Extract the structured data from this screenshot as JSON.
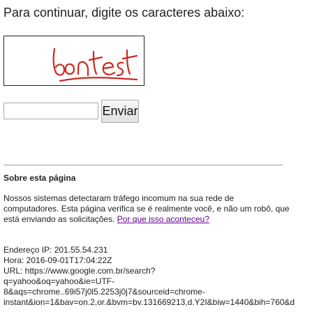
{
  "prompt": "Para continuar, digite os caracteres abaixo:",
  "captcha": {
    "text": "bontest",
    "ink_color": "#cc2a1e"
  },
  "answer_input": {
    "value": "",
    "placeholder": ""
  },
  "submit_label": "Enviar",
  "about": {
    "title": "Sobre esta página",
    "body": "Nossos sistemas detectaram tráfego incomum na sua rede de computadores. Esta página verifica se é realmente você, e não um robô, que está enviando as solicitações.",
    "link": "Por que isso aconteceu?"
  },
  "details": {
    "ip": "Endereço IP: 201.55.54.231",
    "time": "Hora: 2016-09-01T17:04:22Z",
    "url_lines": [
      "URL: https://www.google.com.br/search?",
      "q=yahoo&oq=yahoo&ie=UTF-",
      "8&aqs=chrome..69i57j0l5.2253j0j7&sourceid=chrome-",
      "instant&ion=1&bav=on.2,or.&bvm=bv.131669213,d.Y2I&biw=1440&bih=760&d"
    ]
  },
  "colors": {
    "link_visited": "#660099",
    "text": "#222222"
  }
}
